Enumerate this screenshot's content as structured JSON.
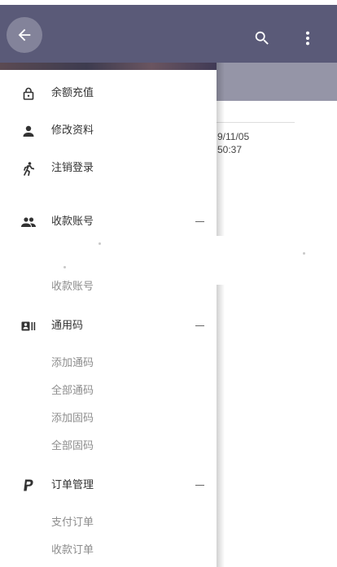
{
  "appbar": {
    "back_icon": "arrow-left-icon",
    "search_icon": "search-icon",
    "more_icon": "more-vert-icon",
    "color": "#5a5a78"
  },
  "background": {
    "date": "9/11/05",
    "time": "50:37"
  },
  "drawer": {
    "items": [
      {
        "icon": "lock-icon",
        "label": "余额充值"
      },
      {
        "icon": "person-icon",
        "label": "修改资料"
      },
      {
        "icon": "run-icon",
        "label": "注销登录"
      }
    ],
    "groups": [
      {
        "icon": "people-icon",
        "label": "收款账号",
        "expanded": true,
        "children": [
          "收款账号"
        ]
      },
      {
        "icon": "badge-icon",
        "label": "通用码",
        "expanded": true,
        "children": [
          "添加通码",
          "全部通码",
          "添加固码",
          "全部固码"
        ]
      },
      {
        "icon": "paypal-icon",
        "label": "订单管理",
        "expanded": true,
        "children": [
          "支付订单",
          "收款订单"
        ]
      }
    ]
  }
}
